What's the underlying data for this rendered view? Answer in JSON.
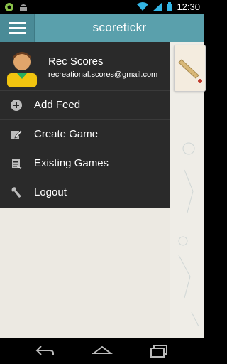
{
  "status_bar": {
    "time": "12:30"
  },
  "app_bar": {
    "title": "scoretickr",
    "menu_icon": "hamburger-icon"
  },
  "drawer": {
    "profile": {
      "name": "Rec Scores",
      "email": "recreational.scores@gmail.com"
    },
    "items": [
      {
        "label": "Add Feed",
        "icon": "plus-circle-icon"
      },
      {
        "label": "Create Game",
        "icon": "edit-icon"
      },
      {
        "label": "Existing Games",
        "icon": "clipboard-icon"
      },
      {
        "label": "Logout",
        "icon": "wrench-icon"
      }
    ]
  },
  "nav_bar": {
    "back_icon": "back-icon",
    "home_icon": "home-icon",
    "recents_icon": "recents-icon"
  },
  "colors": {
    "accent": "#5aa0ac",
    "drawer_bg": "#2a2a2a",
    "content_bg": "#ece9e2"
  }
}
